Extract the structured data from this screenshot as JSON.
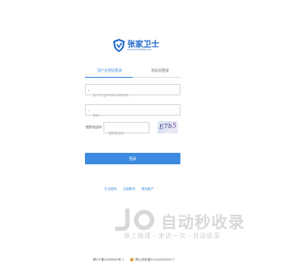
{
  "brand": {
    "title": "张家卫士",
    "subtitle": "ZHANGJIAWEISHI",
    "accent_color": "#3d8be0",
    "logo_color": "#1a66c8"
  },
  "tabs": [
    {
      "label": "用户名密码登录",
      "active": true
    },
    {
      "label": "验证码登录",
      "active": false
    }
  ],
  "form": {
    "username_placeholder": "用户名/证件号码/手机号码",
    "password_placeholder": "密码",
    "captcha_label": "图形验证码",
    "captcha_required_mark": "*",
    "captcha_placeholder": "图形验证码",
    "captcha_image_text": "E7b5",
    "login_label": "登录"
  },
  "links": {
    "forgot_password": "忘记密码",
    "register": "注册账号",
    "change_account": "更改账户"
  },
  "watermark": {
    "main": "自动秒收录",
    "sub": "做上链接→来访一次→自动收录"
  },
  "footer": {
    "icp": "豫ICP备19005000号-1",
    "police": "豫公网安备41011602000177"
  }
}
